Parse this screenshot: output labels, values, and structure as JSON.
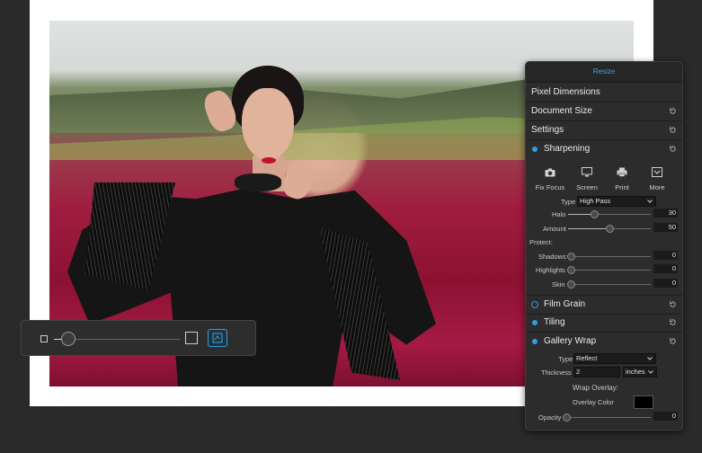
{
  "panel": {
    "title": "Resize",
    "pixel_dimensions": "Pixel Dimensions",
    "document_size": "Document Size",
    "settings": "Settings",
    "sharpening": {
      "label": "Sharpening",
      "presets": [
        {
          "label": "Fix Focus",
          "icon": "camera-icon"
        },
        {
          "label": "Screen",
          "icon": "monitor-icon"
        },
        {
          "label": "Print",
          "icon": "printer-icon"
        },
        {
          "label": "More",
          "icon": "more-icon"
        }
      ],
      "type_label": "Type",
      "type_value": "High Pass",
      "halo_label": "Halo",
      "halo_value": "30",
      "amount_label": "Amount",
      "amount_value": "50",
      "protect_label": "Protect:",
      "shadows_label": "Shadows",
      "shadows_value": "0",
      "highlights_label": "Highlights",
      "highlights_value": "0",
      "skin_label": "Skin",
      "skin_value": "0"
    },
    "film_grain": "Film Grain",
    "tiling": "Tiling",
    "gallery_wrap": {
      "label": "Gallery Wrap",
      "type_label": "Type",
      "type_value": "Reflect",
      "thickness_label": "Thickness",
      "thickness_value": "2",
      "unit_value": "inches",
      "wrap_overlay": "Wrap Overlay:",
      "overlay_color_label": "Overlay Color",
      "overlay_color": "#000000",
      "opacity_label": "Opacity",
      "opacity_value": "0"
    }
  },
  "colors": {
    "accent": "#2e9fe0",
    "panel_bg": "#2c2c2c",
    "app_bg": "#2a2a2a"
  }
}
